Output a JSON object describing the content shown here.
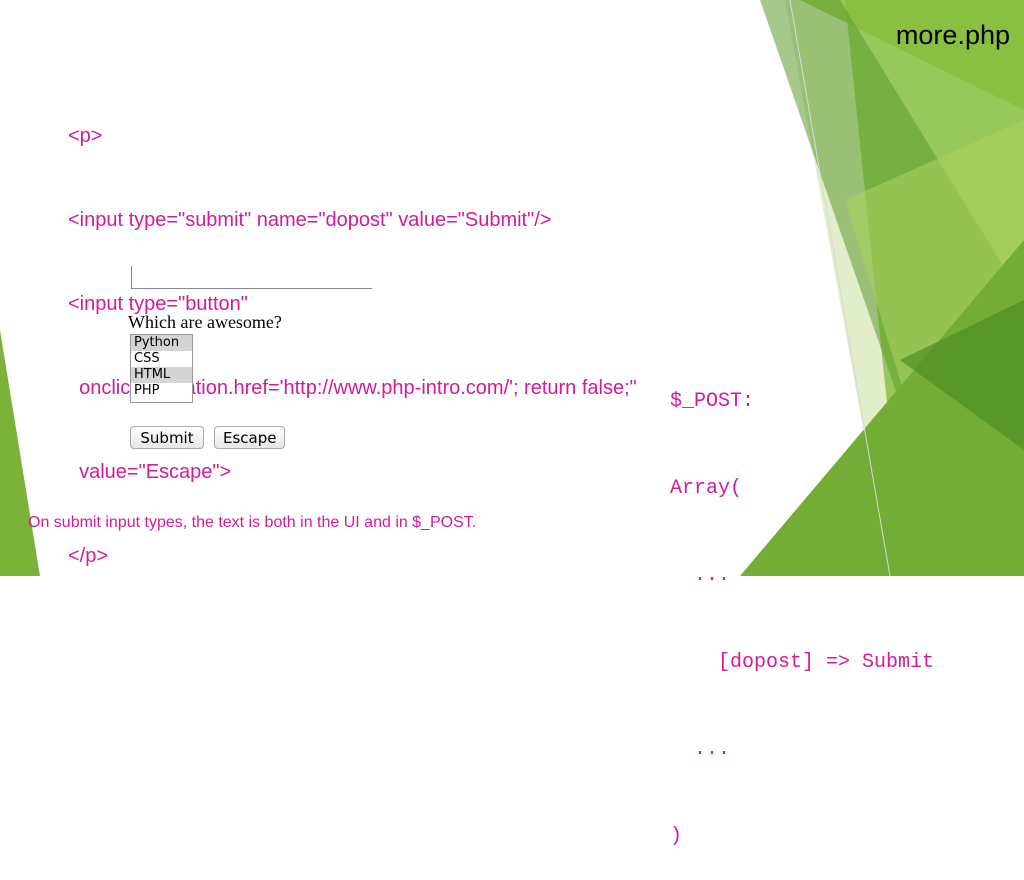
{
  "slide": {
    "title": "more.php",
    "code_lines": [
      "<p>",
      "<input type=\"submit\" name=\"dopost\" value=\"Submit\"/>",
      "<input type=\"button\"",
      "  onclick=\"location.href='http://www.php-intro.com/'; return false;\"",
      "  value=\"Escape\">",
      "</p>"
    ],
    "form_demo": {
      "question": "Which are awesome?",
      "list_options": [
        "Python",
        "CSS",
        "HTML",
        "PHP"
      ],
      "selected_options": [
        "Python",
        "HTML"
      ],
      "submit_label": "Submit",
      "escape_label": "Escape"
    },
    "post_dump": [
      "$_POST:",
      "Array(",
      "  ...",
      "    [dopost] => Submit",
      "  ...",
      ")"
    ],
    "caption": "On submit input types, the text is both in the UI and in $_POST.",
    "colors": {
      "accent_text": "#d6199b",
      "green_dark": "#4f8f2a",
      "green_mid": "#79b33b",
      "green_light": "#a5cd5e"
    }
  }
}
